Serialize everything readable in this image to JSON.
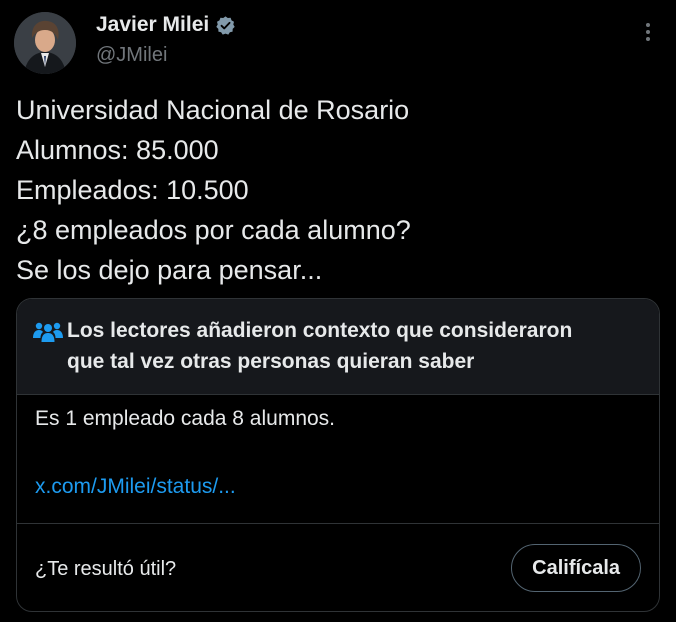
{
  "author": {
    "name": "Javier Milei",
    "handle": "@JMilei",
    "avatar_icon": "profile-photo",
    "verified_icon": "verified-badge-icon"
  },
  "tweet": {
    "lines": [
      "Universidad Nacional de Rosario",
      "Alumnos: 85.000",
      "Empleados: 10.500",
      "¿8 empleados por cada alumno?",
      "Se los dejo para pensar..."
    ]
  },
  "community_note": {
    "icon": "readers-icon",
    "title_lines": [
      "Los lectores añadieron contexto que consideraron",
      "que tal vez otras personas quieran saber"
    ],
    "body": "Es 1 empleado cada 8 alumnos.",
    "link_text": "x.com/JMilei/status/...",
    "helpful_question": "¿Te resultó útil?",
    "rate_button": "Califícala"
  },
  "colors": {
    "background": "#000000",
    "text": "#e7e9ea",
    "secondary_text": "#71767b",
    "link": "#1d9bf0",
    "border": "#2f3336",
    "note_header_bg": "#16181c"
  }
}
